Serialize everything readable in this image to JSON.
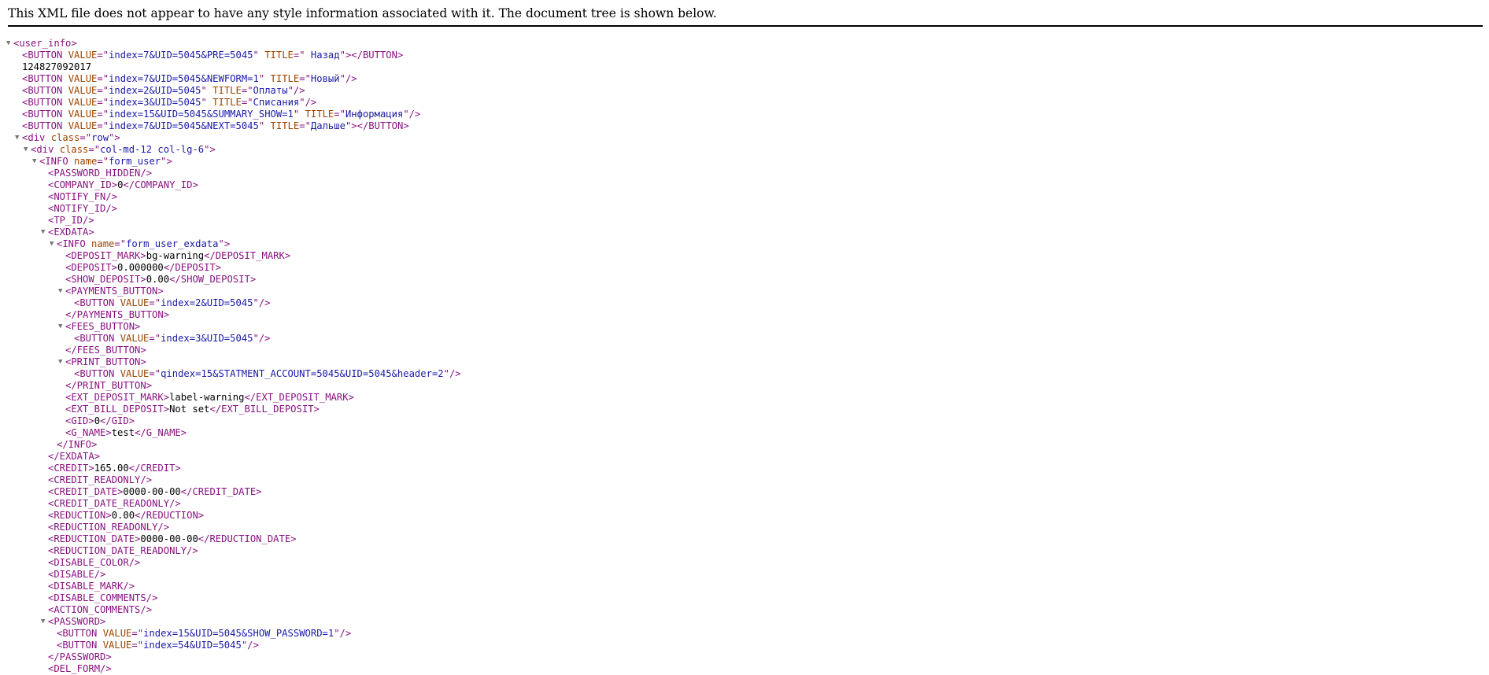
{
  "header_text": "This XML file does not appear to have any style information associated with it. The document tree is shown below.",
  "lines": [
    {
      "indent": 0,
      "toggle": true,
      "parts": [
        [
          "t",
          "<user_info>"
        ]
      ]
    },
    {
      "indent": 1,
      "parts": [
        [
          "t",
          "<BUTTON "
        ],
        [
          "a",
          "VALUE"
        ],
        [
          "t",
          "=\""
        ],
        [
          "v",
          "index=7&UID=5045&PRE=5045"
        ],
        [
          "t",
          "\" "
        ],
        [
          "a",
          "TITLE"
        ],
        [
          "t",
          "=\""
        ],
        [
          "v",
          " Назад"
        ],
        [
          "t",
          "\"></BUTTON>"
        ]
      ]
    },
    {
      "indent": 1,
      "parts": [
        [
          "x",
          "124827092017"
        ]
      ]
    },
    {
      "indent": 1,
      "parts": [
        [
          "t",
          "<BUTTON "
        ],
        [
          "a",
          "VALUE"
        ],
        [
          "t",
          "=\""
        ],
        [
          "v",
          "index=7&UID=5045&NEWFORM=1"
        ],
        [
          "t",
          "\" "
        ],
        [
          "a",
          "TITLE"
        ],
        [
          "t",
          "=\""
        ],
        [
          "v",
          "Новый"
        ],
        [
          "t",
          "\"/>"
        ]
      ]
    },
    {
      "indent": 1,
      "parts": [
        [
          "t",
          "<BUTTON "
        ],
        [
          "a",
          "VALUE"
        ],
        [
          "t",
          "=\""
        ],
        [
          "v",
          "index=2&UID=5045"
        ],
        [
          "t",
          "\" "
        ],
        [
          "a",
          "TITLE"
        ],
        [
          "t",
          "=\""
        ],
        [
          "v",
          "Оплаты"
        ],
        [
          "t",
          "\"/>"
        ]
      ]
    },
    {
      "indent": 1,
      "parts": [
        [
          "t",
          "<BUTTON "
        ],
        [
          "a",
          "VALUE"
        ],
        [
          "t",
          "=\""
        ],
        [
          "v",
          "index=3&UID=5045"
        ],
        [
          "t",
          "\" "
        ],
        [
          "a",
          "TITLE"
        ],
        [
          "t",
          "=\""
        ],
        [
          "v",
          "Списания"
        ],
        [
          "t",
          "\"/>"
        ]
      ]
    },
    {
      "indent": 1,
      "parts": [
        [
          "t",
          "<BUTTON "
        ],
        [
          "a",
          "VALUE"
        ],
        [
          "t",
          "=\""
        ],
        [
          "v",
          "index=15&UID=5045&SUMMARY_SHOW=1"
        ],
        [
          "t",
          "\" "
        ],
        [
          "a",
          "TITLE"
        ],
        [
          "t",
          "=\""
        ],
        [
          "v",
          "Информация"
        ],
        [
          "t",
          "\"/>"
        ]
      ]
    },
    {
      "indent": 1,
      "parts": [
        [
          "t",
          "<BUTTON "
        ],
        [
          "a",
          "VALUE"
        ],
        [
          "t",
          "=\""
        ],
        [
          "v",
          "index=7&UID=5045&NEXT=5045"
        ],
        [
          "t",
          "\" "
        ],
        [
          "a",
          "TITLE"
        ],
        [
          "t",
          "=\""
        ],
        [
          "v",
          "Дальше"
        ],
        [
          "t",
          "\"></BUTTON>"
        ]
      ]
    },
    {
      "indent": 1,
      "toggle": true,
      "parts": [
        [
          "t",
          "<div "
        ],
        [
          "a",
          "class"
        ],
        [
          "t",
          "=\""
        ],
        [
          "v",
          "row"
        ],
        [
          "t",
          "\">"
        ]
      ]
    },
    {
      "indent": 2,
      "toggle": true,
      "parts": [
        [
          "t",
          "<div "
        ],
        [
          "a",
          "class"
        ],
        [
          "t",
          "=\""
        ],
        [
          "v",
          "col-md-12 col-lg-6"
        ],
        [
          "t",
          "\">"
        ]
      ]
    },
    {
      "indent": 3,
      "toggle": true,
      "parts": [
        [
          "t",
          "<INFO "
        ],
        [
          "a",
          "name"
        ],
        [
          "t",
          "=\""
        ],
        [
          "v",
          "form_user"
        ],
        [
          "t",
          "\">"
        ]
      ]
    },
    {
      "indent": 4,
      "parts": [
        [
          "t",
          "<PASSWORD_HIDDEN/>"
        ]
      ]
    },
    {
      "indent": 4,
      "parts": [
        [
          "t",
          "<COMPANY_ID>"
        ],
        [
          "x",
          "0"
        ],
        [
          "t",
          "</COMPANY_ID>"
        ]
      ]
    },
    {
      "indent": 4,
      "parts": [
        [
          "t",
          "<NOTIFY_FN/>"
        ]
      ]
    },
    {
      "indent": 4,
      "parts": [
        [
          "t",
          "<NOTIFY_ID/>"
        ]
      ]
    },
    {
      "indent": 4,
      "parts": [
        [
          "t",
          "<TP_ID/>"
        ]
      ]
    },
    {
      "indent": 4,
      "toggle": true,
      "parts": [
        [
          "t",
          "<EXDATA>"
        ]
      ]
    },
    {
      "indent": 5,
      "toggle": true,
      "parts": [
        [
          "t",
          "<INFO "
        ],
        [
          "a",
          "name"
        ],
        [
          "t",
          "=\""
        ],
        [
          "v",
          "form_user_exdata"
        ],
        [
          "t",
          "\">"
        ]
      ]
    },
    {
      "indent": 6,
      "parts": [
        [
          "t",
          "<DEPOSIT_MARK>"
        ],
        [
          "x",
          "bg-warning"
        ],
        [
          "t",
          "</DEPOSIT_MARK>"
        ]
      ]
    },
    {
      "indent": 6,
      "parts": [
        [
          "t",
          "<DEPOSIT>"
        ],
        [
          "x",
          "0.000000"
        ],
        [
          "t",
          "</DEPOSIT>"
        ]
      ]
    },
    {
      "indent": 6,
      "parts": [
        [
          "t",
          "<SHOW_DEPOSIT>"
        ],
        [
          "x",
          "0.00"
        ],
        [
          "t",
          "</SHOW_DEPOSIT>"
        ]
      ]
    },
    {
      "indent": 6,
      "toggle": true,
      "parts": [
        [
          "t",
          "<PAYMENTS_BUTTON>"
        ]
      ]
    },
    {
      "indent": 7,
      "parts": [
        [
          "t",
          "<BUTTON "
        ],
        [
          "a",
          "VALUE"
        ],
        [
          "t",
          "=\""
        ],
        [
          "v",
          "index=2&UID=5045"
        ],
        [
          "t",
          "\"/>"
        ]
      ]
    },
    {
      "indent": 6,
      "parts": [
        [
          "t",
          "</PAYMENTS_BUTTON>"
        ]
      ]
    },
    {
      "indent": 6,
      "toggle": true,
      "parts": [
        [
          "t",
          "<FEES_BUTTON>"
        ]
      ]
    },
    {
      "indent": 7,
      "parts": [
        [
          "t",
          "<BUTTON "
        ],
        [
          "a",
          "VALUE"
        ],
        [
          "t",
          "=\""
        ],
        [
          "v",
          "index=3&UID=5045"
        ],
        [
          "t",
          "\"/>"
        ]
      ]
    },
    {
      "indent": 6,
      "parts": [
        [
          "t",
          "</FEES_BUTTON>"
        ]
      ]
    },
    {
      "indent": 6,
      "toggle": true,
      "parts": [
        [
          "t",
          "<PRINT_BUTTON>"
        ]
      ]
    },
    {
      "indent": 7,
      "parts": [
        [
          "t",
          "<BUTTON "
        ],
        [
          "a",
          "VALUE"
        ],
        [
          "t",
          "=\""
        ],
        [
          "v",
          "qindex=15&STATMENT_ACCOUNT=5045&UID=5045&header=2"
        ],
        [
          "t",
          "\"/>"
        ]
      ]
    },
    {
      "indent": 6,
      "parts": [
        [
          "t",
          "</PRINT_BUTTON>"
        ]
      ]
    },
    {
      "indent": 6,
      "parts": [
        [
          "t",
          "<EXT_DEPOSIT_MARK>"
        ],
        [
          "x",
          "label-warning"
        ],
        [
          "t",
          "</EXT_DEPOSIT_MARK>"
        ]
      ]
    },
    {
      "indent": 6,
      "parts": [
        [
          "t",
          "<EXT_BILL_DEPOSIT>"
        ],
        [
          "x",
          "Not set"
        ],
        [
          "t",
          "</EXT_BILL_DEPOSIT>"
        ]
      ]
    },
    {
      "indent": 6,
      "parts": [
        [
          "t",
          "<GID>"
        ],
        [
          "x",
          "0"
        ],
        [
          "t",
          "</GID>"
        ]
      ]
    },
    {
      "indent": 6,
      "parts": [
        [
          "t",
          "<G_NAME>"
        ],
        [
          "x",
          "test"
        ],
        [
          "t",
          "</G_NAME>"
        ]
      ]
    },
    {
      "indent": 5,
      "parts": [
        [
          "t",
          "</INFO>"
        ]
      ]
    },
    {
      "indent": 4,
      "parts": [
        [
          "t",
          "</EXDATA>"
        ]
      ]
    },
    {
      "indent": 4,
      "parts": [
        [
          "t",
          "<CREDIT>"
        ],
        [
          "x",
          "165.00"
        ],
        [
          "t",
          "</CREDIT>"
        ]
      ]
    },
    {
      "indent": 4,
      "parts": [
        [
          "t",
          "<CREDIT_READONLY/>"
        ]
      ]
    },
    {
      "indent": 4,
      "parts": [
        [
          "t",
          "<CREDIT_DATE>"
        ],
        [
          "x",
          "0000-00-00"
        ],
        [
          "t",
          "</CREDIT_DATE>"
        ]
      ]
    },
    {
      "indent": 4,
      "parts": [
        [
          "t",
          "<CREDIT_DATE_READONLY/>"
        ]
      ]
    },
    {
      "indent": 4,
      "parts": [
        [
          "t",
          "<REDUCTION>"
        ],
        [
          "x",
          "0.00"
        ],
        [
          "t",
          "</REDUCTION>"
        ]
      ]
    },
    {
      "indent": 4,
      "parts": [
        [
          "t",
          "<REDUCTION_READONLY/>"
        ]
      ]
    },
    {
      "indent": 4,
      "parts": [
        [
          "t",
          "<REDUCTION_DATE>"
        ],
        [
          "x",
          "0000-00-00"
        ],
        [
          "t",
          "</REDUCTION_DATE>"
        ]
      ]
    },
    {
      "indent": 4,
      "parts": [
        [
          "t",
          "<REDUCTION_DATE_READONLY/>"
        ]
      ]
    },
    {
      "indent": 4,
      "parts": [
        [
          "t",
          "<DISABLE_COLOR/>"
        ]
      ]
    },
    {
      "indent": 4,
      "parts": [
        [
          "t",
          "<DISABLE/>"
        ]
      ]
    },
    {
      "indent": 4,
      "parts": [
        [
          "t",
          "<DISABLE_MARK/>"
        ]
      ]
    },
    {
      "indent": 4,
      "parts": [
        [
          "t",
          "<DISABLE_COMMENTS/>"
        ]
      ]
    },
    {
      "indent": 4,
      "parts": [
        [
          "t",
          "<ACTION_COMMENTS/>"
        ]
      ]
    },
    {
      "indent": 4,
      "toggle": true,
      "parts": [
        [
          "t",
          "<PASSWORD>"
        ]
      ]
    },
    {
      "indent": 5,
      "parts": [
        [
          "t",
          "<BUTTON "
        ],
        [
          "a",
          "VALUE"
        ],
        [
          "t",
          "=\""
        ],
        [
          "v",
          "index=15&UID=5045&SHOW_PASSWORD=1"
        ],
        [
          "t",
          "\"/>"
        ]
      ]
    },
    {
      "indent": 5,
      "parts": [
        [
          "t",
          "<BUTTON "
        ],
        [
          "a",
          "VALUE"
        ],
        [
          "t",
          "=\""
        ],
        [
          "v",
          "index=54&UID=5045"
        ],
        [
          "t",
          "\"/>"
        ]
      ]
    },
    {
      "indent": 4,
      "parts": [
        [
          "t",
          "</PASSWORD>"
        ]
      ]
    },
    {
      "indent": 4,
      "parts": [
        [
          "t",
          "<DEL_FORM/>"
        ]
      ]
    }
  ],
  "toggle_glyph": "▼"
}
